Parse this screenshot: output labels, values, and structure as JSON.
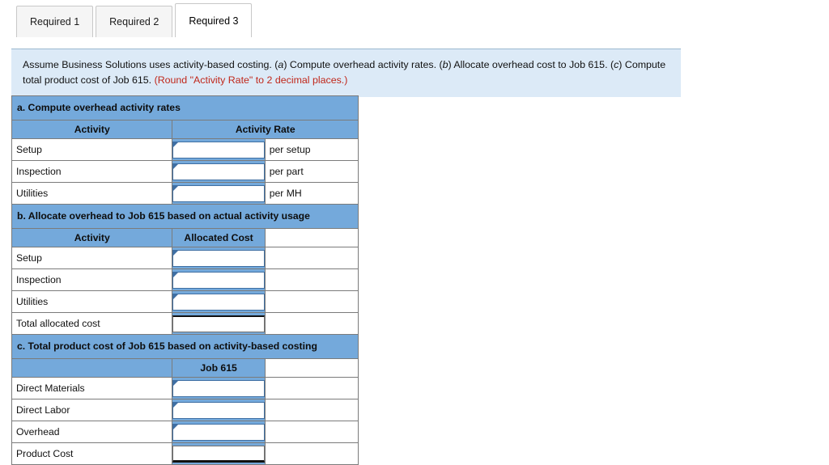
{
  "tabs": [
    {
      "label": "Required 1",
      "active": false
    },
    {
      "label": "Required 2",
      "active": false
    },
    {
      "label": "Required 3",
      "active": true
    }
  ],
  "instruction": {
    "part1": "Assume Business Solutions uses activity-based costing. (",
    "a": "a",
    "part2": ") Compute overhead activity rates. (",
    "b": "b",
    "part3": ") Allocate overhead cost to Job 615. (",
    "c": "c",
    "part4": ") Compute total product cost of Job 615. ",
    "round_note": "(Round \"Activity Rate\" to 2 decimal places.)"
  },
  "sections": {
    "a": {
      "heading": "a. Compute overhead activity rates",
      "col_activity": "Activity",
      "col_rate": "Activity Rate",
      "rows": [
        {
          "label": "Setup",
          "value": "",
          "unit": "per setup"
        },
        {
          "label": "Inspection",
          "value": "",
          "unit": "per part"
        },
        {
          "label": "Utilities",
          "value": "",
          "unit": "per MH"
        }
      ]
    },
    "b": {
      "heading": "b. Allocate overhead to Job 615 based on actual activity usage",
      "col_activity": "Activity",
      "col_cost": "Allocated Cost",
      "rows": [
        {
          "label": "Setup",
          "value": ""
        },
        {
          "label": "Inspection",
          "value": ""
        },
        {
          "label": "Utilities",
          "value": ""
        }
      ],
      "total_label": "Total allocated cost",
      "total_value": ""
    },
    "c": {
      "heading": "c. Total product cost of Job 615 based on activity-based costing",
      "col_blank": "",
      "col_job": "Job 615",
      "rows": [
        {
          "label": "Direct Materials",
          "value": ""
        },
        {
          "label": "Direct Labor",
          "value": ""
        },
        {
          "label": "Overhead",
          "value": ""
        }
      ],
      "total_label": "Product Cost",
      "total_value": ""
    }
  },
  "colors": {
    "header_blue": "#74a9db",
    "banner_blue": "#dceaf7",
    "note_red": "#c0271a",
    "grid_gray": "#7b7b7b"
  }
}
